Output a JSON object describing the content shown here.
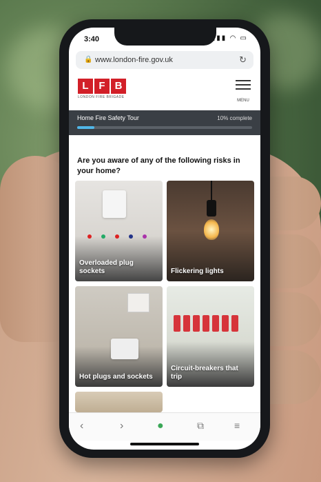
{
  "status_bar": {
    "time": "3:40"
  },
  "browser": {
    "url": "www.london-fire.gov.uk"
  },
  "site": {
    "logo_letters": [
      "L",
      "F",
      "B"
    ],
    "logo_subtitle": "LONDON FIRE BRIGADE",
    "menu_label": "MENU"
  },
  "tour": {
    "title": "Home Fire Safety Tour",
    "progress_text": "10% complete",
    "progress_fraction": 0.1
  },
  "question": "Are you aware of any of the following risks in your home?",
  "cards": [
    {
      "label": "Overloaded plug sockets"
    },
    {
      "label": "Flickering lights"
    },
    {
      "label": "Hot plugs and sockets"
    },
    {
      "label": "Circuit-breakers that trip"
    }
  ],
  "colors": {
    "brand_red": "#d21f28",
    "tour_bar": "#3a3f45",
    "progress": "#50b6e8"
  },
  "icons": {
    "lock": "lock-icon",
    "reload": "reload-icon",
    "menu": "hamburger-icon",
    "back": "chevron-left-icon",
    "forward": "chevron-right-icon",
    "tabs": "tabs-icon",
    "more": "hamburger-icon"
  }
}
